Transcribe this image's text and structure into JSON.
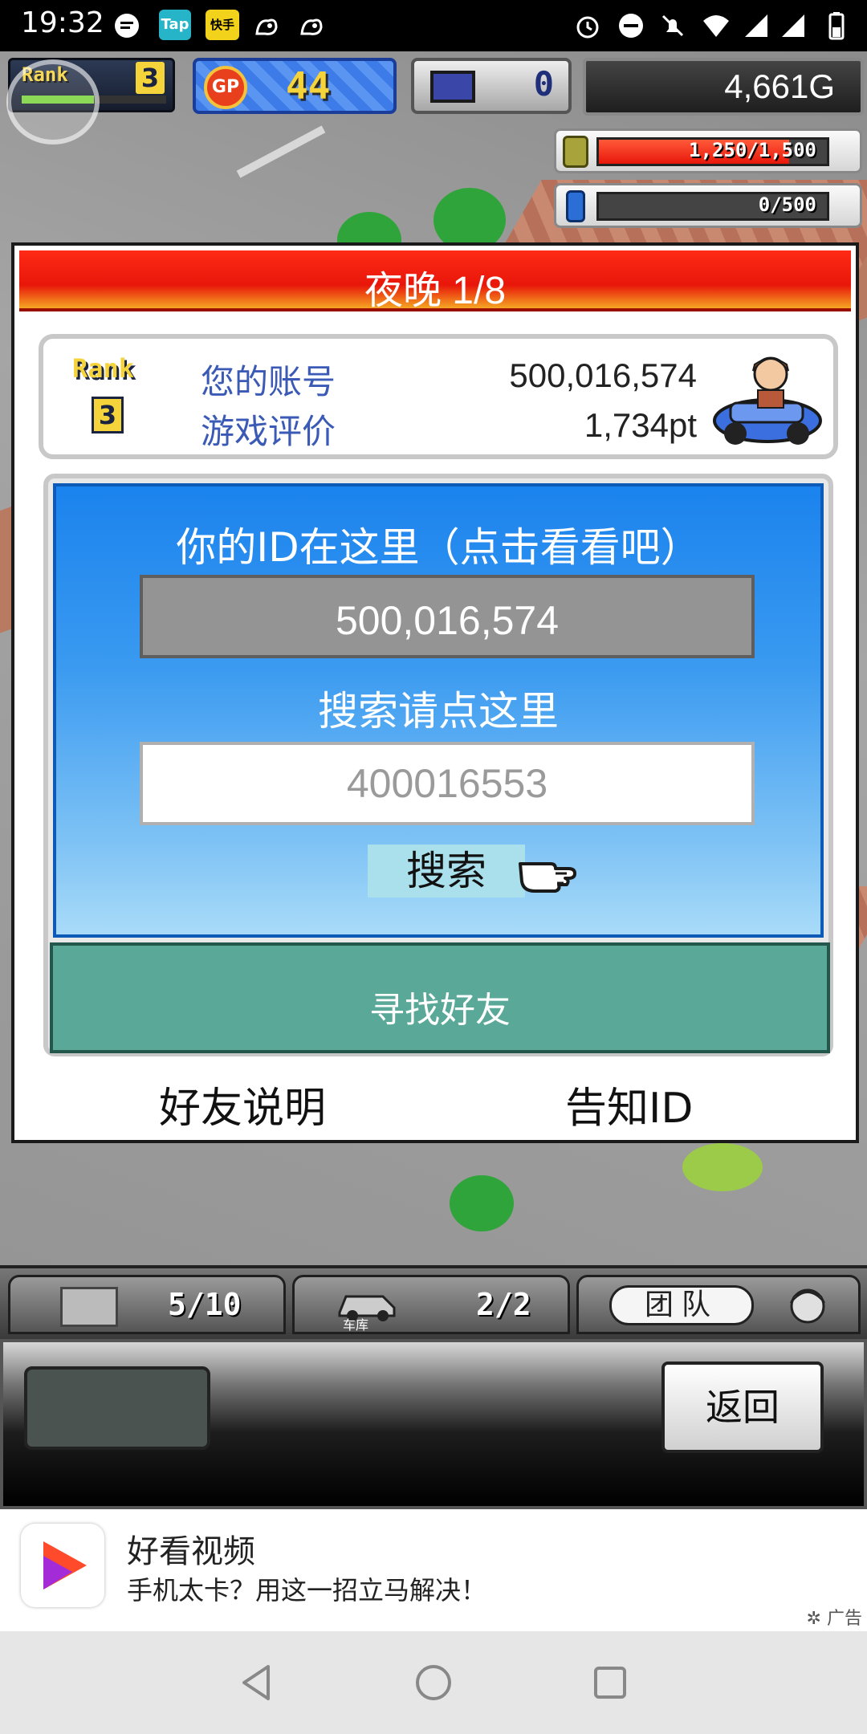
{
  "status_bar": {
    "time": "19:32",
    "app_icons": [
      "message-icon",
      "taptap-icon",
      "kuaishou-icon",
      "squirrel-icon",
      "squirrel-icon"
    ],
    "taptap_label": "Tap",
    "kuaishou_label": "快手",
    "system_icons": [
      "alarm-icon",
      "dnd-icon",
      "mute-icon",
      "wifi-icon",
      "signal-icon",
      "signal-icon",
      "battery-icon"
    ]
  },
  "hud": {
    "rank_label": "Rank",
    "rank_value": "3",
    "rank_progress": 0.5,
    "gp_label": "GP",
    "gp_value": "44",
    "pc_value": "0",
    "money": "4,661G",
    "coins": {
      "text": "1,250/1,500",
      "fraction": 0.833
    },
    "gems": {
      "text": "0/500",
      "fraction": 0.0
    }
  },
  "dialog": {
    "title": "夜晚 1/8",
    "rank_label": "Rank",
    "rank_value": "3",
    "account_label": "您的账号",
    "account_value": "500,016,574",
    "rating_label": "游戏评价",
    "rating_value": "1,734pt",
    "id_title": "你的ID在这里（点击看看吧）",
    "id_value": "500,016,574",
    "search_title": "搜索请点这里",
    "search_placeholder": "400016553",
    "search_button": "搜索",
    "find_friend_button": "寻找好友",
    "friend_help_link": "好友说明",
    "share_id_link": "告知ID"
  },
  "bottom_bar": {
    "storage_count": "5/10",
    "garage_label": "车库",
    "garage_count": "2/2",
    "team_label": "团队",
    "back_button": "返回"
  },
  "ad": {
    "title": "好看视频",
    "description": "手机太卡？用这一招立马解决！",
    "tag": "广告"
  },
  "colors": {
    "header_red": "#ff2a16",
    "panel_blue": "#1b83ee",
    "find_friend_green": "#5aa898",
    "label_blue": "#3a5ab5"
  }
}
